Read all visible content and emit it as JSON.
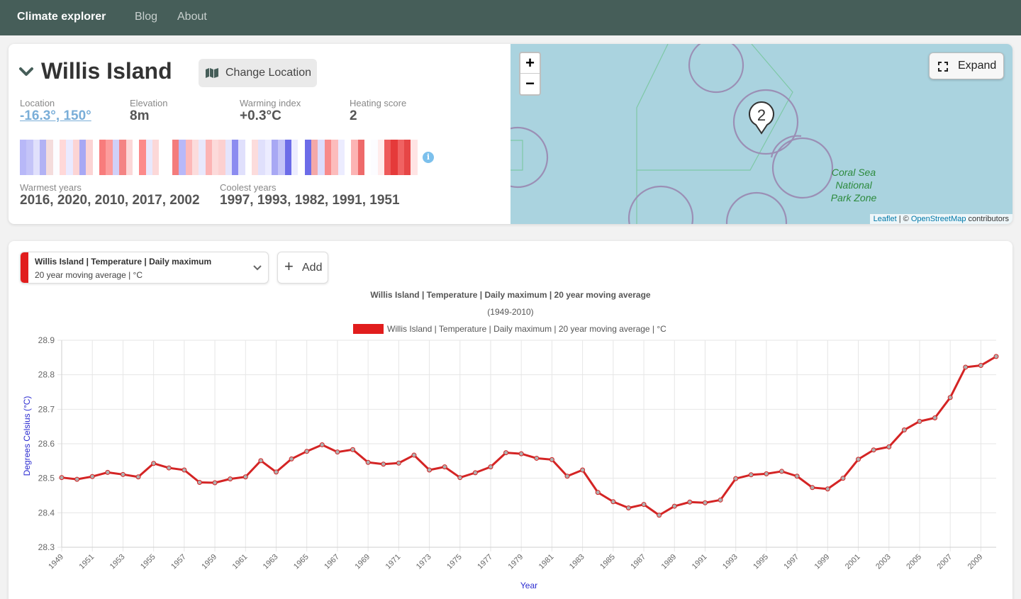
{
  "nav": {
    "brand": "Climate explorer",
    "links": [
      "Blog",
      "About"
    ]
  },
  "location": {
    "name": "Willis Island",
    "change_label": "Change Location",
    "stats": [
      {
        "label": "Location",
        "value": "-16.3°, 150°"
      },
      {
        "label": "Elevation",
        "value": "8m"
      },
      {
        "label": "Warming index",
        "value": "+0.3°C"
      },
      {
        "label": "Heating score",
        "value": "2"
      }
    ],
    "warmest_label": "Warmest years",
    "warmest_value": "2016, 2020, 2010, 2017, 2002",
    "coolest_label": "Coolest years",
    "coolest_value": "1997, 1993, 1982, 1991, 1951",
    "stripe_colors": [
      "#b8b8f8",
      "#c4c4f8",
      "#e0e0fc",
      "#b2b2f4",
      "#f4dcdc",
      "#fcfcff",
      "#ffd8d8",
      "#eaeaff",
      "#fcd4d4",
      "#a8a8f4",
      "#fcd4d4",
      "#ffffff",
      "#f87c7c",
      "#fc9c9c",
      "#d0d0f8",
      "#f48484",
      "#fcd8d8",
      "#ffffff",
      "#fc8a8a",
      "#e8e8fc",
      "#fcd8d8",
      "#ffffff",
      "#ffffff",
      "#f47c7c",
      "#b8b8f8",
      "#fdb8b8",
      "#fcdcdc",
      "#e8e8fc",
      "#fcb4b4",
      "#fcdada",
      "#fcd0d0",
      "#e4e4fc",
      "#8c8cf0",
      "#e0e0fc",
      "#ffffff",
      "#fcdcdc",
      "#e0e0fc",
      "#ececff",
      "#a8a8f4",
      "#c4c4f8",
      "#6c6ce8",
      "#ececff",
      "#ffffff",
      "#6c6ce8",
      "#f4a8a8",
      "#dcdcfc",
      "#f88a8a",
      "#fcbcbc",
      "#ececff",
      "#ffffff",
      "#fcb4b4",
      "#ee6a6a",
      "#ffffff",
      "#fcfcff",
      "#ffecec",
      "#ee5a5a",
      "#e53a3a",
      "#f06262",
      "#e64646",
      "#ffe4e4"
    ],
    "info_icon": "info-icon"
  },
  "map": {
    "zoom_in": "+",
    "zoom_out": "−",
    "expand_label": "Expand",
    "cluster_count": "2",
    "park_label_lines": [
      "Coral Sea",
      "National",
      "Park Zone"
    ],
    "attribution_leaflet": "Leaflet",
    "attribution_sep": " | © ",
    "attribution_osm": "OpenStreetMap",
    "attribution_tail": " contributors"
  },
  "chart_panel": {
    "series_line1": "Willis Island | Temperature | Daily maximum",
    "series_line2": "20 year moving average | °C",
    "series_color": "#e11d1d",
    "add_label": "Add"
  },
  "chart_data": {
    "type": "line",
    "title": "Willis Island | Temperature | Daily maximum | 20 year moving average",
    "subtitle": "(1949-2010)",
    "legend": "Willis Island | Temperature | Daily maximum | 20 year moving average | °C",
    "xlabel": "Year",
    "ylabel": "Degrees Celsius (°C)",
    "ylim": [
      28.3,
      28.9
    ],
    "yticks": [
      28.3,
      28.4,
      28.5,
      28.6,
      28.7,
      28.8,
      28.9
    ],
    "xtick_labels": [
      "1949",
      "1951",
      "1953",
      "1955",
      "1957",
      "1959",
      "1961",
      "1963",
      "1965",
      "1967",
      "1969",
      "1971",
      "1973",
      "1975",
      "1977",
      "1979",
      "1981",
      "1983",
      "1985",
      "1987",
      "1989",
      "1991",
      "1993",
      "1995",
      "1997",
      "1999",
      "2001",
      "2003",
      "2005",
      "2007",
      "2009"
    ],
    "x": [
      1949,
      1950,
      1951,
      1952,
      1953,
      1954,
      1955,
      1956,
      1957,
      1958,
      1959,
      1960,
      1961,
      1962,
      1963,
      1964,
      1965,
      1966,
      1967,
      1968,
      1969,
      1970,
      1971,
      1972,
      1973,
      1974,
      1975,
      1976,
      1977,
      1978,
      1979,
      1980,
      1981,
      1982,
      1983,
      1984,
      1985,
      1986,
      1987,
      1988,
      1989,
      1990,
      1991,
      1992,
      1993,
      1994,
      1995,
      1996,
      1997,
      1998,
      1999,
      2000,
      2001,
      2002,
      2003,
      2004,
      2005,
      2006,
      2007,
      2008,
      2009,
      2010
    ],
    "series": [
      {
        "name": "Willis Island | Temperature | Daily maximum | 20 year moving average | °C",
        "color": "#d42424",
        "values": [
          28.502,
          28.497,
          28.505,
          28.517,
          28.511,
          28.504,
          28.543,
          28.53,
          28.524,
          28.488,
          28.487,
          28.498,
          28.504,
          28.551,
          28.518,
          28.556,
          28.578,
          28.597,
          28.576,
          28.583,
          28.546,
          28.541,
          28.544,
          28.567,
          28.524,
          28.533,
          28.502,
          28.516,
          28.533,
          28.574,
          28.571,
          28.558,
          28.554,
          28.506,
          28.524,
          28.459,
          28.432,
          28.414,
          28.424,
          28.393,
          28.419,
          28.431,
          28.429,
          28.437,
          28.499,
          28.51,
          28.513,
          28.52,
          28.506,
          28.473,
          28.469,
          28.5,
          28.555,
          28.582,
          28.591,
          28.64,
          28.665,
          28.675,
          28.734,
          28.822,
          28.827,
          28.853
        ]
      }
    ]
  }
}
